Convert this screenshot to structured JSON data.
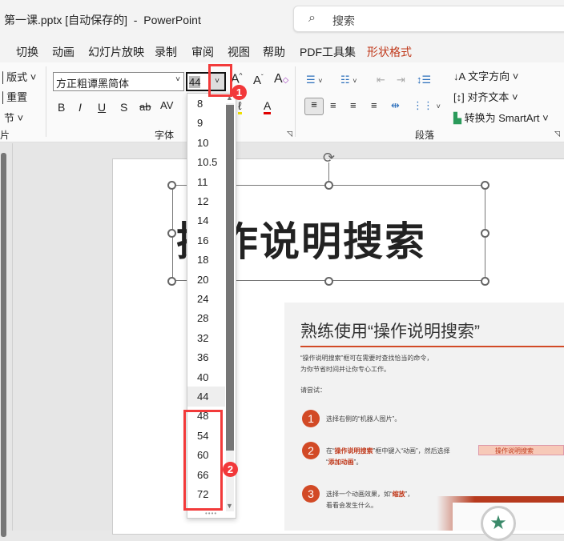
{
  "window": {
    "title": "第一课.pptx [自动保存的]  -  PowerPoint",
    "search_placeholder": "搜索"
  },
  "tabs": [
    "切换",
    "动画",
    "幻灯片放映",
    "录制",
    "审阅",
    "视图",
    "帮助",
    "PDF工具集",
    "形状格式"
  ],
  "colors": {
    "accent_tab": "#c0391b",
    "annotation": "#f23a3a"
  },
  "ribbon": {
    "slides": {
      "layout": "版式",
      "reset": "重置",
      "section": "节",
      "label": "片"
    },
    "font": {
      "font_name": "方正粗谭黑简体",
      "font_size": "44",
      "bold": "B",
      "italic": "I",
      "underline": "U",
      "shadow": "S",
      "strike": "ab",
      "spacing": "AV",
      "label": "字体"
    },
    "paragraph": {
      "label": "段落",
      "text_direction": "文字方向",
      "align_text": "对齐文本",
      "smartart": "转换为 SmartArt"
    }
  },
  "size_options": [
    "8",
    "9",
    "10",
    "10.5",
    "11",
    "12",
    "14",
    "16",
    "18",
    "20",
    "24",
    "28",
    "32",
    "36",
    "40",
    "44",
    "48",
    "54",
    "60",
    "66",
    "72"
  ],
  "selected_size": "44",
  "annotations": [
    "1",
    "2"
  ],
  "slide": {
    "title_text": "操作说明搜索"
  },
  "preview": {
    "title": "熟练使用“操作说明搜索”",
    "line1": "“操作说明搜索”框可在需要时查找恰当的命令，",
    "line2": "为你节省时间并让你专心工作。",
    "try": "请尝试：",
    "steps": [
      {
        "n": "1",
        "text": "选择右侧的“机器人图片”。"
      },
      {
        "n": "2",
        "pre": "在“",
        "hl": "操作说明搜索",
        "mid": "”框中键入“动画”，然后选择",
        "hl2": "添加动画",
        "post": "”。"
      },
      {
        "n": "3",
        "pre": "选择一个动画效果，如“",
        "hl": "缩放",
        "post": "”，",
        "line2": "看看会发生什么。"
      }
    ],
    "search_box": "操作说明搜索"
  }
}
